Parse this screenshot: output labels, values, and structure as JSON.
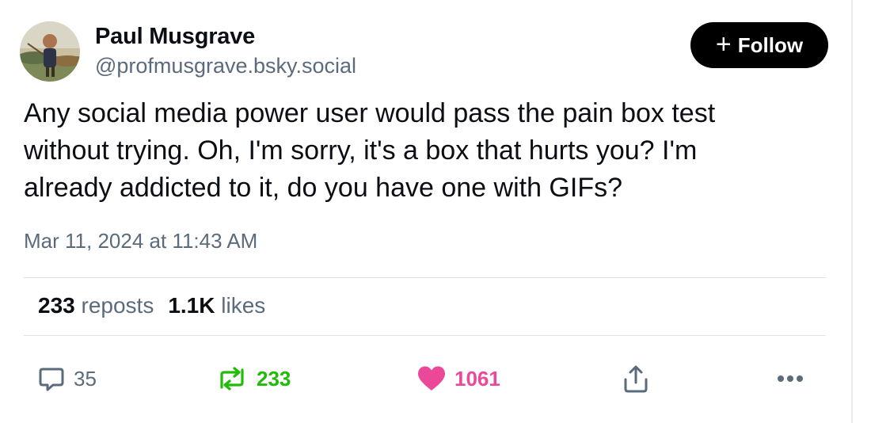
{
  "author": {
    "display_name": "Paul Musgrave",
    "handle": "@profmusgrave.bsky.social"
  },
  "follow_button": {
    "icon": "plus-icon",
    "label": "Follow"
  },
  "post": {
    "lines": [
      "Any social media power user would pass the pain box test",
      "without trying. Oh, I'm sorry, it's a box that hurts you? I'm",
      "already addicted to it, do you have one with GIFs?"
    ],
    "timestamp": "Mar 11, 2024 at 11:43 AM"
  },
  "stats": {
    "reposts_count": "233",
    "reposts_label": "reposts",
    "likes_count": "1.1K",
    "likes_label": "likes"
  },
  "actions": {
    "reply": {
      "icon": "reply-bubble-icon",
      "count": "35",
      "color": "#5b6b7c"
    },
    "repost": {
      "icon": "repost-icon",
      "count": "233",
      "color": "#20bc07"
    },
    "like": {
      "icon": "heart-icon",
      "count": "1061",
      "color": "#ec4899"
    },
    "share": {
      "icon": "share-icon"
    },
    "more": {
      "icon": "more-dots-icon"
    }
  },
  "colors": {
    "follow_bg": "#000000",
    "muted_text": "#5b6b7c",
    "divider": "#dfe3e8"
  }
}
